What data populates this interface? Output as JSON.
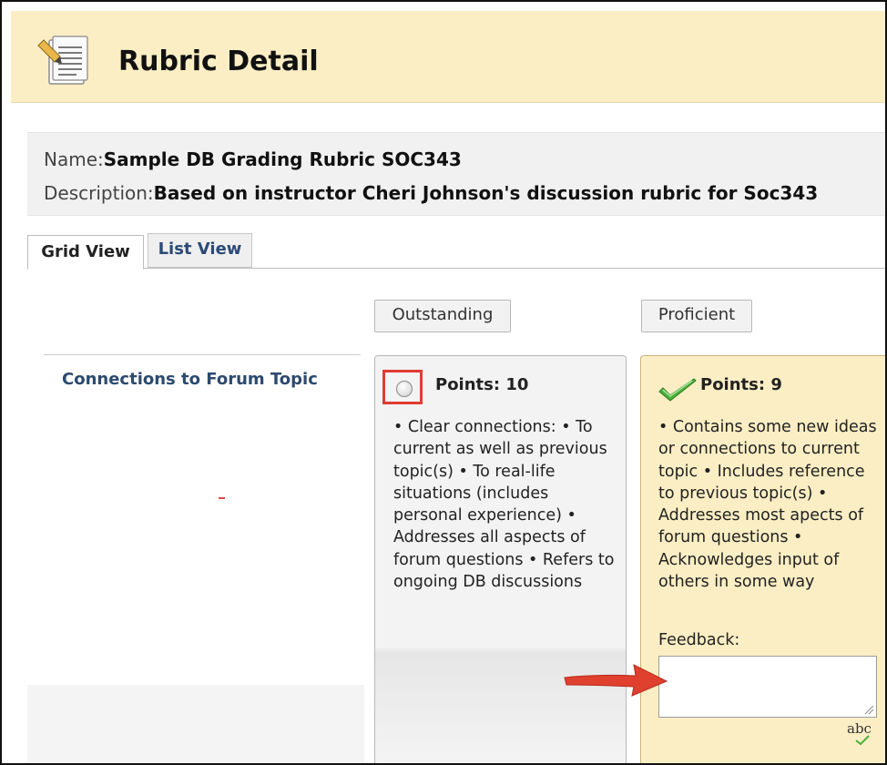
{
  "header": {
    "title": "Rubric Detail"
  },
  "info": {
    "name_label": "Name:",
    "name_value": "Sample DB Grading Rubric SOC343",
    "description_label": "Description:",
    "description_value": "Based on instructor Cheri Johnson's discussion rubric for Soc343"
  },
  "tabs": [
    {
      "label": "Grid View",
      "active": true
    },
    {
      "label": "List View",
      "active": false
    }
  ],
  "columns": [
    {
      "label": "Outstanding"
    },
    {
      "label": "Proficient"
    }
  ],
  "criterion": {
    "label": "Connections to Forum Topic"
  },
  "cells": {
    "outstanding": {
      "points": "Points: 10",
      "description": "• Clear connections: • To current as well as previous topic(s) • To real-life situations (includes personal experience) • Addresses all aspects of forum questions • Refers to ongoing DB discussions",
      "selected": false
    },
    "proficient": {
      "points": "Points: 9",
      "description": "• Contains some new ideas or connections to current topic • Includes reference to previous topic(s) • Addresses most apects of forum questions • Acknowledges input of others in some way",
      "selected": true,
      "feedback_label": "Feedback:",
      "feedback_value": "",
      "spellcheck_label": "abc"
    }
  },
  "colors": {
    "header_bg": "#fbeec4",
    "highlight_red": "#e03c31",
    "check_green": "#4caf3a",
    "criterion_text": "#2d4a6e"
  },
  "icons": [
    "rubric-document-icon",
    "selected-checkmark-icon",
    "spellcheck-icon",
    "resize-grip-icon",
    "annotation-arrow"
  ]
}
